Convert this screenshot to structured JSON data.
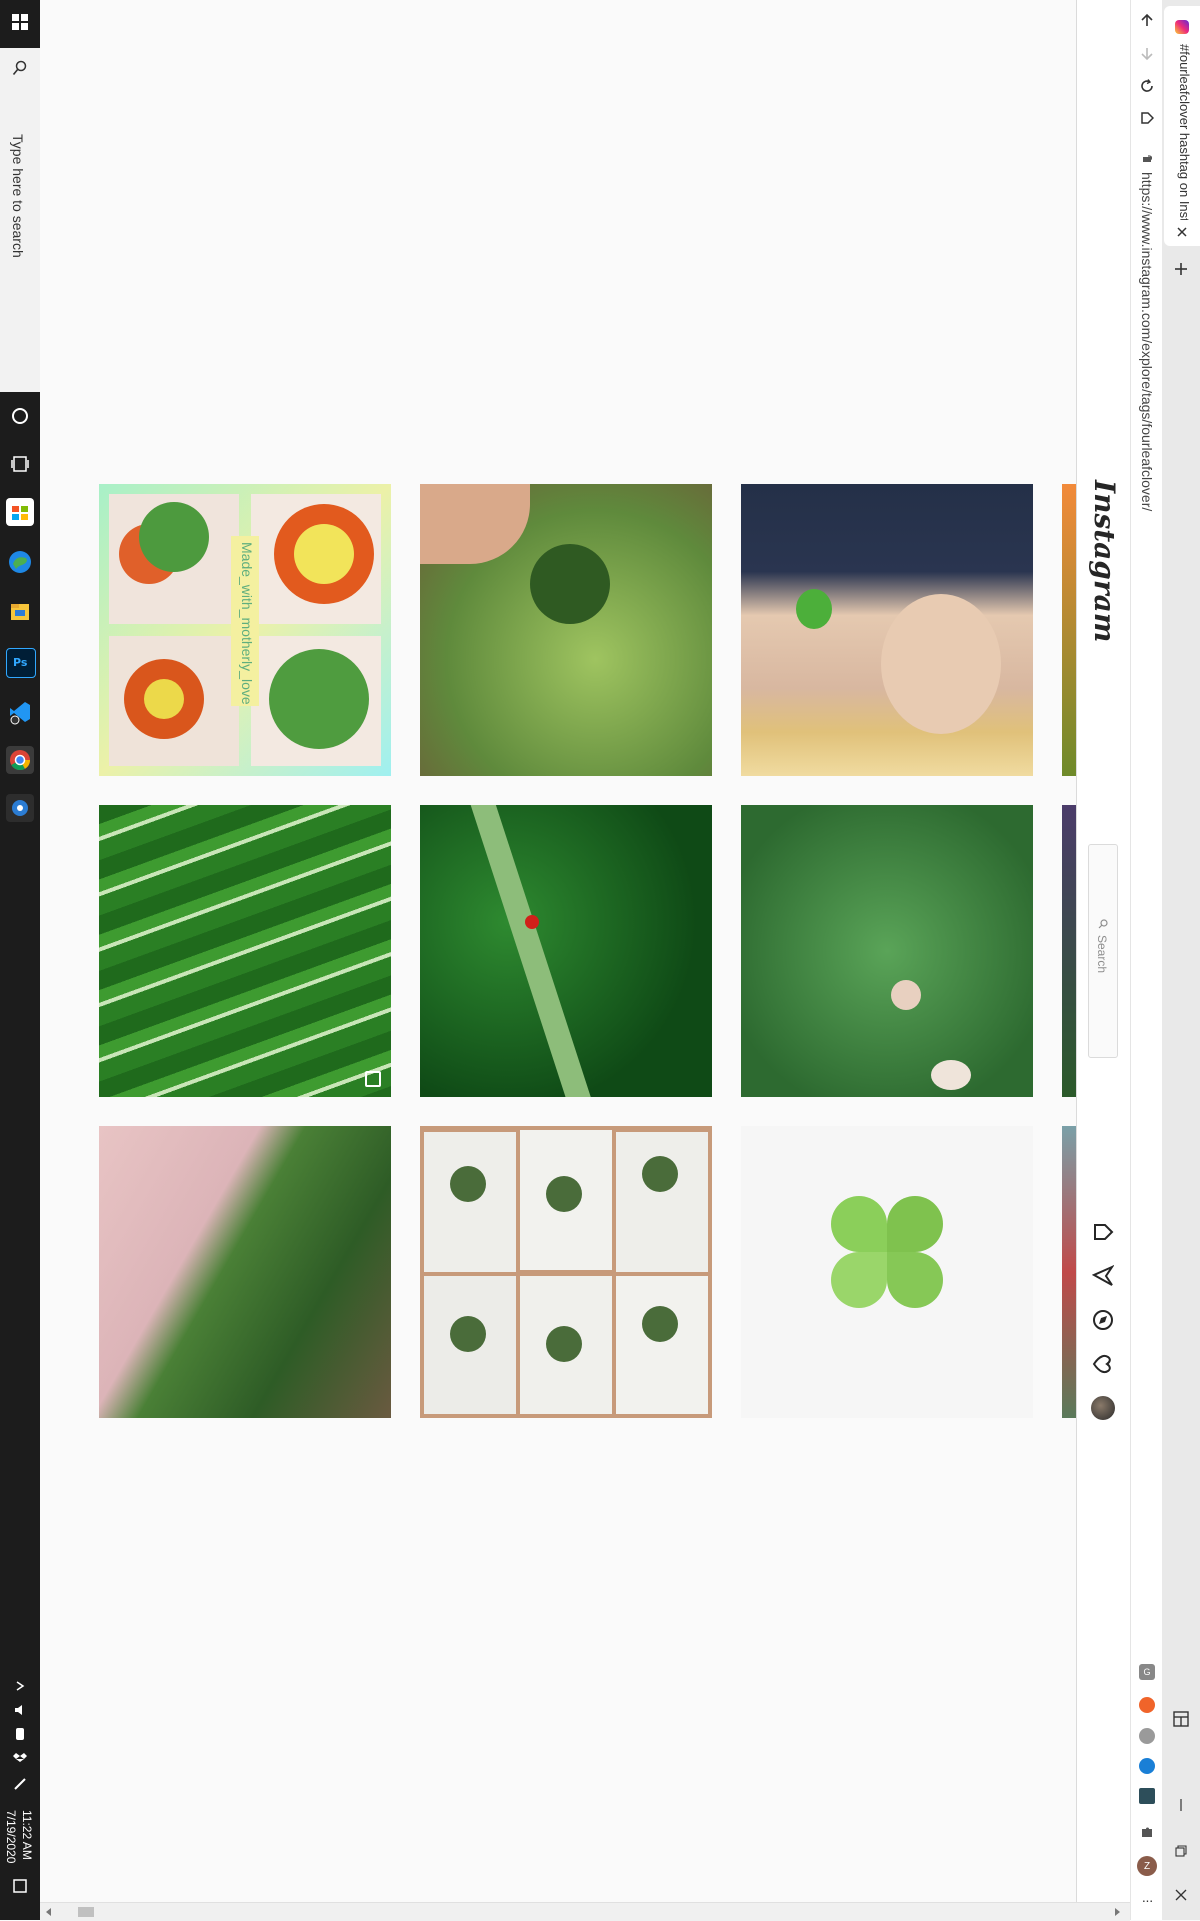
{
  "taskbar": {
    "search_placeholder": "Type here to search",
    "clock_time": "11:22 AM",
    "clock_date": "7/19/2020",
    "apps": [
      "cortana-icon",
      "task-view-icon",
      "store-icon",
      "edge-icon",
      "file-explorer-icon",
      "photoshop-icon",
      "vscode-icon",
      "chrome-icon",
      "settings-icon"
    ]
  },
  "browser": {
    "tab_title": "#fourleafclover hashtag on Insta",
    "url": "https://www.instagram.com/explore/tags/fourleafclover/",
    "nav": [
      "back-icon",
      "forward-icon",
      "reload-icon",
      "home-icon"
    ],
    "extensions": [
      "grammarly-icon",
      "extension-orange-icon",
      "extension-gray-icon",
      "extension-blue-icon",
      "extension-monitor-icon",
      "puzzle-icon",
      "profile-z-icon",
      "more-icon"
    ]
  },
  "instagram": {
    "logo": "Instagram",
    "search_placeholder": "Search",
    "nav_icons": [
      "home-icon",
      "direct-icon",
      "explore-icon",
      "activity-heart-icon",
      "profile-avatar-icon"
    ]
  },
  "grid": {
    "overlay_text": "Made_with_motherly_love",
    "rows": [
      [
        "partial-leaf",
        "clover-crafts-collage",
        "hand-holding-clover",
        "girl-with-clover",
        "partial-orange"
      ],
      [
        "partial-clover",
        "green-pattern-art",
        "ladybug-on-stem",
        "clover-patch",
        "partial-purple"
      ],
      [
        "partial-dog",
        "hand-picking-clover",
        "pressed-clover-cards",
        "paper-origami-clover",
        "partial-flowers"
      ]
    ]
  },
  "colors": {
    "taskbar": "#1c1c1c",
    "accent_instagram": "#c13584",
    "page_bg": "#fafafa"
  }
}
